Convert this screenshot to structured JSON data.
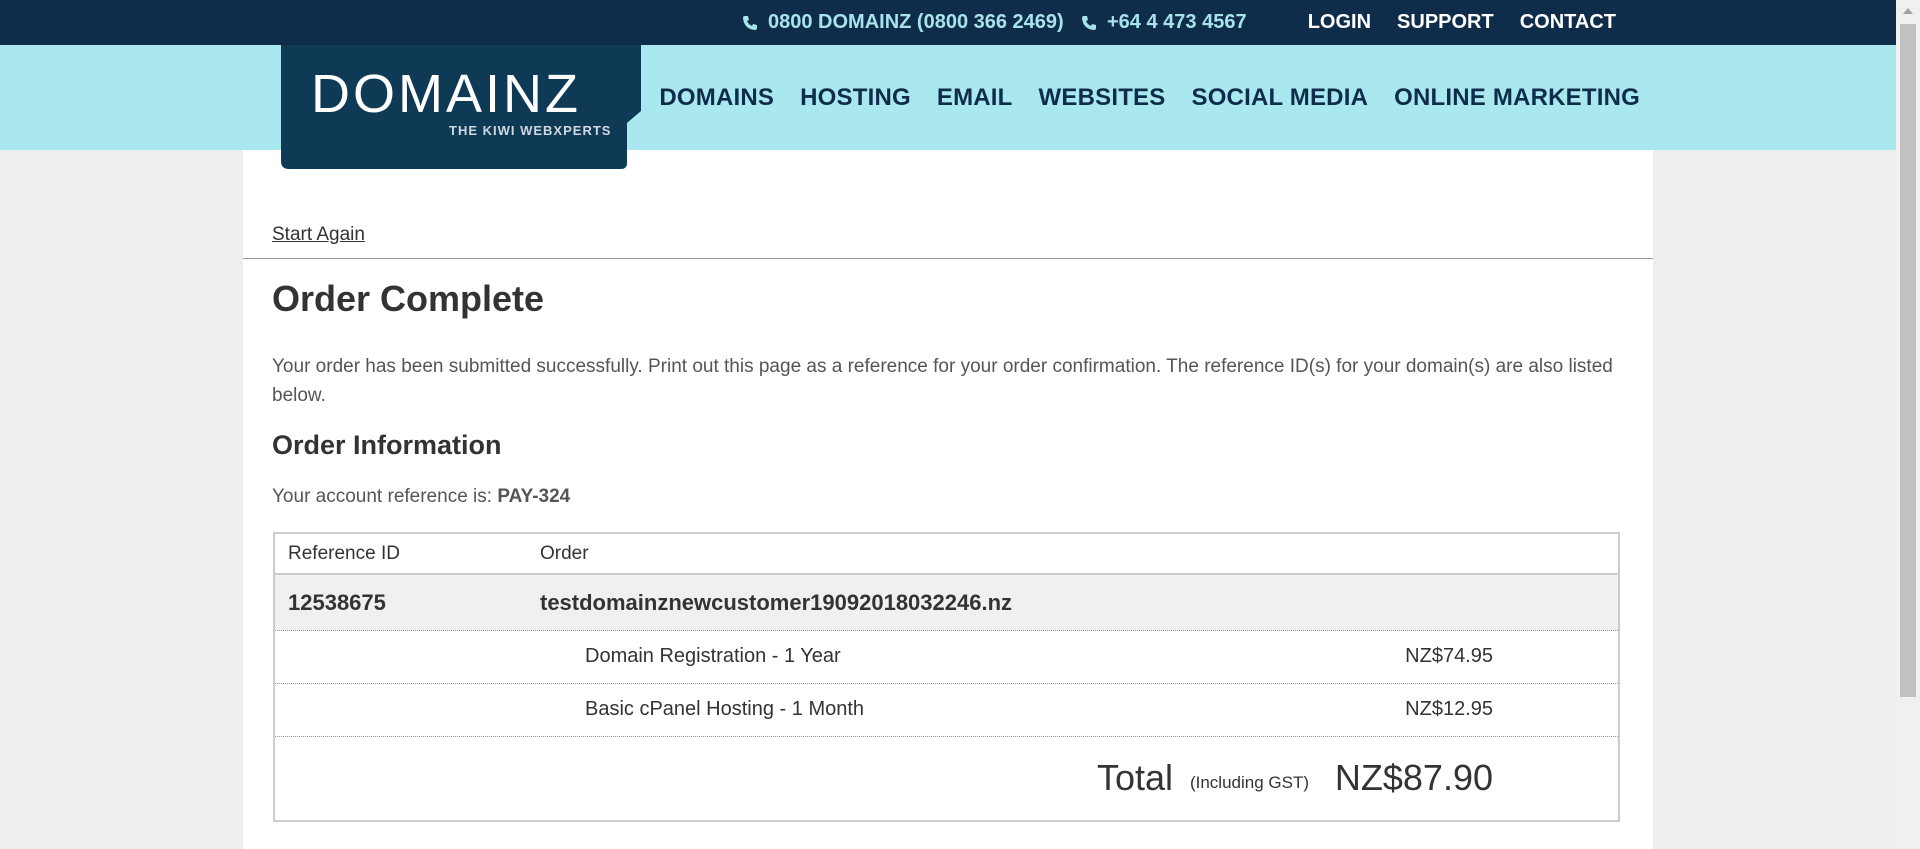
{
  "header": {
    "phone1": "0800 DOMAINZ (0800 366 2469)",
    "phone2": "+64 4 473 4567",
    "links": [
      "LOGIN",
      "SUPPORT",
      "CONTACT"
    ]
  },
  "nav": {
    "items": [
      "DOMAINS",
      "HOSTING",
      "EMAIL",
      "WEBSITES",
      "SOCIAL MEDIA",
      "ONLINE MARKETING"
    ]
  },
  "logo": {
    "name": "DOMAINZ",
    "tagline": "THE KIWI WEBXPERTS"
  },
  "page": {
    "start_again": "Start Again",
    "title": "Order Complete",
    "intro": "Your order has been submitted successfully. Print out this page as a reference for your order confirmation. The reference ID(s) for your domain(s) are also listed below.",
    "section_title": "Order Information",
    "account_prefix": "Your account reference is: ",
    "account_ref": "PAY-324"
  },
  "table": {
    "headers": [
      "Reference ID",
      "Order"
    ],
    "reference_id": "12538675",
    "domain": "testdomainznewcustomer19092018032246.nz",
    "items": [
      {
        "label": "Domain Registration - 1 Year",
        "price": "NZ$74.95"
      },
      {
        "label": "Basic cPanel Hosting - 1 Month",
        "price": "NZ$12.95"
      }
    ],
    "total_label": "Total",
    "total_note": "(Including GST)",
    "total_amount": "NZ$87.90"
  },
  "colors": {
    "topbar": "#0f2d4a",
    "navbar": "#a8e8ee",
    "accent_text": "#a8e3ec"
  },
  "icons": [
    "phone-icon"
  ]
}
